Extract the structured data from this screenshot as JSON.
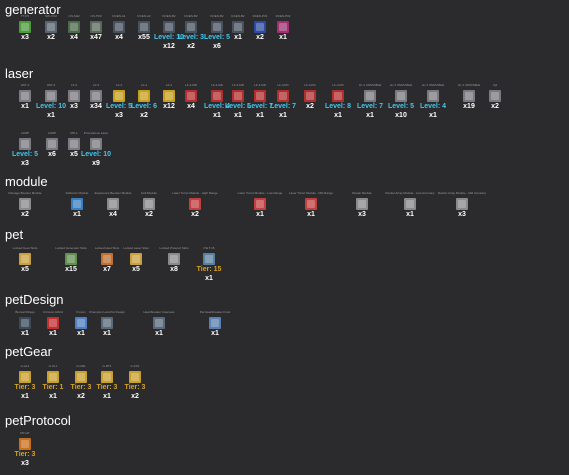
{
  "colors": {
    "background": "#2b2b2d",
    "level": "#3fc7ee",
    "tier": "#d9a020",
    "count": "#ffffff",
    "item_name": "#9a9a9a"
  },
  "sections": [
    {
      "title": "generator",
      "items": [
        {
          "name": "TT-P3",
          "count": "x3",
          "level": "",
          "icon": "generator-icon",
          "color": "#4c9a3c"
        },
        {
          "name": "SW-CO2",
          "count": "x2",
          "level": "",
          "icon": "generator-icon",
          "color": "#5a6470"
        },
        {
          "name": "CN-SH2",
          "count": "x4",
          "level": "",
          "icon": "generator-icon",
          "color": "#4c6a4c"
        },
        {
          "name": "CN-TR3",
          "count": "x47",
          "level": "",
          "icon": "generator-icon",
          "color": "#5a6a5a"
        },
        {
          "name": "DCEN-A1",
          "count": "x4",
          "level": "",
          "icon": "generator-icon",
          "color": "#48525e"
        },
        {
          "name": "DCEN-A2",
          "count": "x55",
          "level": "",
          "icon": "generator-icon",
          "color": "#48525e"
        },
        {
          "name": "DCEN-B2",
          "count": "x12",
          "level": "Level: 10",
          "icon": "generator-icon",
          "color": "#48525e"
        },
        {
          "name": "DCEN-B3",
          "count": "x2",
          "level": "Level: 3",
          "icon": "generator-icon",
          "color": "#48525e"
        },
        {
          "name": "DCEN-B2",
          "count": "x6",
          "level": "Level: 5",
          "icon": "generator-icon",
          "color": "#48525e"
        },
        {
          "name": "DCEN-B2",
          "count": "x1",
          "level": "",
          "icon": "generator-icon",
          "color": "#48525e"
        },
        {
          "name": "DCEN-P01",
          "count": "x2",
          "level": "",
          "icon": "generator-icon",
          "color": "#2c4ca0"
        },
        {
          "name": "DCEN-P02",
          "count": "x1",
          "level": "",
          "icon": "generator-icon",
          "color": "#a03070"
        }
      ]
    },
    {
      "title": "laser",
      "items": [
        {
          "name": "HST-1",
          "count": "x1",
          "level": "",
          "icon": "laser-icon",
          "color": "#7a7a80"
        },
        {
          "name": "HST-2",
          "count": "x1",
          "level": "Level: 10",
          "icon": "laser-icon",
          "color": "#7a7a80"
        },
        {
          "name": "LF-3",
          "count": "x3",
          "level": "",
          "icon": "laser-icon",
          "color": "#7a7a80"
        },
        {
          "name": "LF-3",
          "count": "x34",
          "level": "",
          "icon": "laser-icon",
          "color": "#7a7a80"
        },
        {
          "name": "LF-4",
          "count": "x3",
          "level": "Level: 5",
          "icon": "laser-icon",
          "color": "#c8a020"
        },
        {
          "name": "LF-4",
          "count": "x2",
          "level": "Level: 6",
          "icon": "laser-icon",
          "color": "#c8a020"
        },
        {
          "name": "LF-4",
          "count": "x12",
          "level": "",
          "icon": "laser-icon",
          "color": "#c8a020"
        },
        {
          "name": "LF-4-MD",
          "count": "x4",
          "level": "",
          "icon": "laser-icon",
          "color": "#b03030"
        },
        {
          "name": "LF-4-MD",
          "count": "x1",
          "level": "Level: 4",
          "icon": "laser-icon",
          "color": "#b03030"
        },
        {
          "name": "LF-4-MD",
          "count": "x1",
          "level": "Level: 5",
          "icon": "laser-icon",
          "color": "#b03030"
        },
        {
          "name": "LF-4-MD",
          "count": "x1",
          "level": "Level: 7",
          "icon": "laser-icon",
          "color": "#b03030"
        },
        {
          "name": "LF-4-PD",
          "count": "x1",
          "level": "Level: 7",
          "icon": "laser-icon",
          "color": "#b03030"
        },
        {
          "name": "LF-4-PD",
          "count": "x2",
          "level": "",
          "icon": "laser-icon",
          "color": "#b03030"
        },
        {
          "name": "LF-4-PD",
          "count": "x1",
          "level": "Level: 8",
          "icon": "laser-icon",
          "color": "#b03030"
        },
        {
          "name": "LF-4 UNSTABLE",
          "count": "x1",
          "level": "Level: 7",
          "icon": "laser-icon",
          "color": "#7a7a80"
        },
        {
          "name": "LF-4 UNSTABLE",
          "count": "x10",
          "level": "Level: 5",
          "icon": "laser-icon",
          "color": "#7a7a80"
        },
        {
          "name": "LF-4 UNSTABLE",
          "count": "x1",
          "level": "Level: 4",
          "icon": "laser-icon",
          "color": "#7a7a80"
        },
        {
          "name": "LF-4 UNSTABLE",
          "count": "x19",
          "level": "",
          "icon": "laser-icon",
          "color": "#7a7a80"
        },
        {
          "name": "Xpl",
          "count": "x2",
          "level": "",
          "icon": "laser-icon",
          "color": "#7a7a80"
        },
        {
          "name": "LFMP",
          "count": "x3",
          "level": "Level: 5",
          "icon": "laser-icon",
          "color": "#7a7a80"
        },
        {
          "name": "LFMP",
          "count": "x6",
          "level": "",
          "icon": "laser-icon",
          "color": "#7a7a80"
        },
        {
          "name": "MP-1",
          "count": "x5",
          "level": "",
          "icon": "laser-icon",
          "color": "#7a7a80"
        },
        {
          "name": "Prometheus Laser",
          "count": "x9",
          "level": "Level: 10",
          "icon": "laser-icon",
          "color": "#7a7a80"
        }
      ]
    },
    {
      "title": "module",
      "items": [
        {
          "name": "Damage Booster Module",
          "count": "x2",
          "level": "",
          "icon": "module-icon",
          "color": "#8a8a8a"
        },
        {
          "name": "Deflector Module",
          "count": "x1",
          "level": "",
          "icon": "module-icon",
          "color": "#3a80c0"
        },
        {
          "name": "Experience Booster Module",
          "count": "x4",
          "level": "",
          "icon": "module-icon",
          "color": "#8a8a8a"
        },
        {
          "name": "Hull Module",
          "count": "x2",
          "level": "",
          "icon": "module-icon",
          "color": "#8a8a8a"
        },
        {
          "name": "Laser Turret Module - High Range",
          "count": "x2",
          "level": "",
          "icon": "module-icon",
          "color": "#c04040"
        },
        {
          "name": "Laser Turret Module - Low Range",
          "count": "x1",
          "level": "",
          "icon": "module-icon",
          "color": "#c04040"
        },
        {
          "name": "Laser Turret Module - Mid Range",
          "count": "x1",
          "level": "",
          "icon": "module-icon",
          "color": "#c04040"
        },
        {
          "name": "Repair Module",
          "count": "x3",
          "level": "",
          "icon": "module-icon",
          "color": "#8a8a8a"
        },
        {
          "name": "Rocket Array Module - Low Accuracy",
          "count": "x1",
          "level": "",
          "icon": "module-icon",
          "color": "#8a8a8a"
        },
        {
          "name": "Rocket Array Module - Mid Accuracy",
          "count": "x3",
          "level": "",
          "icon": "module-icon",
          "color": "#8a8a8a"
        }
      ]
    },
    {
      "title": "pet",
      "items": [
        {
          "name": "Locked Gear Slots",
          "count": "x5",
          "level": "",
          "icon": "lock-icon",
          "color": "#c8a040"
        },
        {
          "name": "Locked Generator Slots",
          "count": "x15",
          "level": "",
          "icon": "lock-icon",
          "color": "#609050"
        },
        {
          "name": "Locked Heat Slots",
          "count": "x7",
          "level": "",
          "icon": "lock-icon",
          "color": "#c07030"
        },
        {
          "name": "Locked Laser Slots",
          "count": "x5",
          "level": "",
          "icon": "lock-icon",
          "color": "#c8a040"
        },
        {
          "name": "Locked Protocol Slots",
          "count": "x8",
          "level": "",
          "icon": "lock-icon",
          "color": "#8a8a8a"
        },
        {
          "name": "P.E.T.15",
          "count": "x1",
          "level": "Tier: 15",
          "icon": "pet-icon",
          "color": "#5a80a0"
        }
      ]
    },
    {
      "title": "petDesign",
      "items": [
        {
          "name": "Bonsai Mirage",
          "count": "x1",
          "level": "",
          "icon": "pet-design-icon",
          "color": "#3a4a5a"
        },
        {
          "name": "Crimson Hibrid",
          "count": "x1",
          "level": "",
          "icon": "pet-design-icon",
          "color": "#c03030"
        },
        {
          "name": "Frozen",
          "count": "x1",
          "level": "",
          "icon": "pet-design-icon",
          "color": "#5080c0"
        },
        {
          "name": "Champion Lara Pet Design",
          "count": "x1",
          "level": "",
          "icon": "pet-design-icon",
          "color": "#5a6a7a"
        },
        {
          "name": "Heartbreaker Cuteness",
          "count": "x1",
          "level": "",
          "icon": "pet-design-icon",
          "color": "#5a6a7a"
        },
        {
          "name": "Pet Heartbreaker Frost",
          "count": "x1",
          "level": "",
          "icon": "pet-design-icon",
          "color": "#5a80b0"
        }
      ]
    },
    {
      "title": "petGear",
      "items": [
        {
          "name": "G-AL1",
          "count": "x1",
          "level": "Tier: 3",
          "icon": "pet-gear-icon",
          "color": "#c8a030"
        },
        {
          "name": "G-KL1",
          "count": "x1",
          "level": "Tier: 1",
          "icon": "pet-gear-icon",
          "color": "#c8a030"
        },
        {
          "name": "G-HR1",
          "count": "x2",
          "level": "Tier: 3",
          "icon": "pet-gear-icon",
          "color": "#c8a030"
        },
        {
          "name": "G-RT1",
          "count": "x1",
          "level": "Tier: 3",
          "icon": "pet-gear-icon",
          "color": "#c8a030"
        },
        {
          "name": "G-KK1",
          "count": "x2",
          "level": "Tier: 3",
          "icon": "pet-gear-icon",
          "color": "#c8a030"
        }
      ]
    },
    {
      "title": "petProtocol",
      "items": [
        {
          "name": "PR-HT",
          "count": "x3",
          "level": "Tier: 3",
          "icon": "pet-protocol-icon",
          "color": "#c87020"
        }
      ]
    }
  ]
}
